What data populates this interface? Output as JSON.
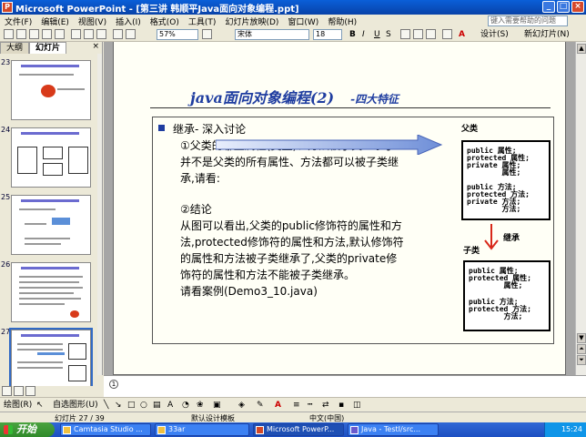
{
  "window": {
    "title": "Microsoft PowerPoint - [第三讲 韩顺平Java面向对象编程.ppt]",
    "app_icon": "P",
    "controls": [
      "_",
      "□",
      "×"
    ]
  },
  "menu": {
    "items": [
      "文件(F)",
      "编辑(E)",
      "视图(V)",
      "插入(I)",
      "格式(O)",
      "工具(T)",
      "幻灯片放映(D)",
      "窗口(W)",
      "帮助(H)"
    ],
    "help_placeholder": "键入需要帮助的问题"
  },
  "toolbar": {
    "zoom": "57%",
    "font": "宋体",
    "font_size": "18",
    "bold": "B",
    "italic": "I",
    "underline": "U",
    "shadow": "S",
    "design_label": "设计(S)",
    "new_slide_label": "新幻灯片(N)"
  },
  "left_panel": {
    "tabs": [
      "大纲",
      "幻灯片"
    ],
    "close": "×",
    "slide_numbers": [
      "23",
      "24",
      "25",
      "26",
      "27"
    ]
  },
  "slide": {
    "title_main": "java面向对象编程(2)",
    "title_sub": "-四大特征",
    "bullet_heading": "继承- 深入讨论",
    "q1_line1": "①父类的哪些属性(变量)、方法被子类继承了?",
    "q1_line2": "并不是父类的所有属性、方法都可以被子类继",
    "q1_line3": "承,请看:",
    "a_heading": "②结论",
    "a_line1": "从图可以看出,父类的public修饰符的属性和方",
    "a_line2": "法,protected修饰符的属性和方法,默认修饰符",
    "a_line3": "的属性和方法被子类继承了,父类的private修",
    "a_line4": "饰符的属性和方法不能被子类继承。",
    "a_line5": "请看案例(Demo3_10.java)",
    "parent_label": "父类",
    "child_label": "子类",
    "inherit_label": "继承",
    "parent_box": [
      "public 属性;",
      "protected 属性;",
      "private 属性;",
      "        属性;",
      "",
      "public 方法;",
      "protected 方法;",
      "private 方法;",
      "        方法;"
    ],
    "child_box": [
      "public 属性;",
      "protected 属性;",
      "        属性;",
      "",
      "public 方法;",
      "protected 方法;",
      "        方法;"
    ]
  },
  "notes": {
    "marker": "1"
  },
  "drawing_toolbar": {
    "draw_label": "绘图(R)",
    "autoshape_label": "自选图形(U)"
  },
  "status_bar": {
    "slide_position": "幻灯片 27 / 39",
    "template": "默认设计模板",
    "language": "中文(中国)"
  },
  "taskbar": {
    "start_label": "开始",
    "tasks": [
      "Camtasia Studio ...",
      "33ar",
      "Microsoft PowerP...",
      "Java - TestI/src..."
    ],
    "clock": "15:24"
  },
  "colors": {
    "title_blue": "#1f3da0",
    "arrow_red": "#d8281a",
    "xp_blue": "#0a5fd8"
  }
}
